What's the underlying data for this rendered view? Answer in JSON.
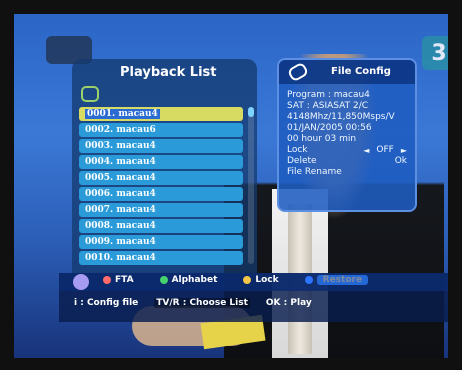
{
  "playback_list": {
    "title": "Playback List",
    "items": [
      "0001. macau4",
      "0002. macau6",
      "0003. macau4",
      "0004. macau4",
      "0005. macau4",
      "0006. macau4",
      "0007. macau4",
      "0008. macau4",
      "0009. macau4",
      "0010. macau4"
    ],
    "selected_index": 0
  },
  "file_config": {
    "title": "File Config",
    "program": "Program : macau4",
    "sat": "SAT : ASIASAT 2/C",
    "freq": "4148Mhz/11,850Msps/V",
    "date": "01/JAN/2005 00:56",
    "duration": "00 hour 03 min",
    "lock_label": "Lock",
    "lock_value": "OFF",
    "delete_label": "Delete",
    "delete_value": "Ok",
    "rename_label": "File Rename"
  },
  "footer": {
    "keys": [
      {
        "label": "FTA",
        "color": "#ff6b6b"
      },
      {
        "label": "Alphabet",
        "color": "#45d16b"
      },
      {
        "label": "Lock",
        "color": "#f3c64a"
      },
      {
        "label": "Restore",
        "color": "#2c73ff"
      }
    ],
    "help": {
      "config": "i : Config file",
      "choose": "TV/R : Choose List",
      "play": "OK : Play"
    }
  },
  "overlay": {
    "channel_number": "3"
  },
  "icons": {
    "info": "info-icon",
    "playback": "playback-icon",
    "config": "config-icon",
    "arrow_left": "triangle-left",
    "arrow_right": "triangle-right"
  }
}
